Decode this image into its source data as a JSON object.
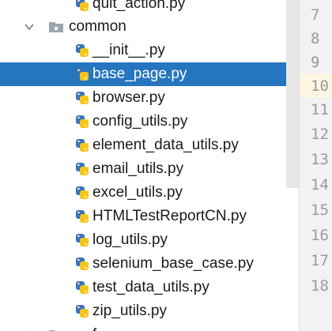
{
  "project_tree": {
    "top_partial_item": "quit_action.py",
    "folder": {
      "label": "common",
      "expanded": true
    },
    "files": [
      "__init__.py",
      "base_page.py",
      "browser.py",
      "config_utils.py",
      "element_data_utils.py",
      "email_utils.py",
      "excel_utils.py",
      "HTMLTestReportCN.py",
      "log_utils.py",
      "selenium_base_case.py",
      "test_data_utils.py",
      "zip_utils.py"
    ],
    "selected_file": "base_page.py",
    "bottom_partial_folder": "f"
  },
  "editor_gutter": {
    "line_numbers": [
      "7",
      "8",
      "9",
      "10",
      "11",
      "12",
      "13",
      "14",
      "15",
      "16",
      "17",
      "18"
    ],
    "current_line": "10"
  },
  "colors": {
    "selection": "#2675bf",
    "python_blue": "#3a73b8",
    "python_yellow": "#f5c518",
    "folder": "#9aa7b0",
    "current_line": "#fdf6e3"
  }
}
